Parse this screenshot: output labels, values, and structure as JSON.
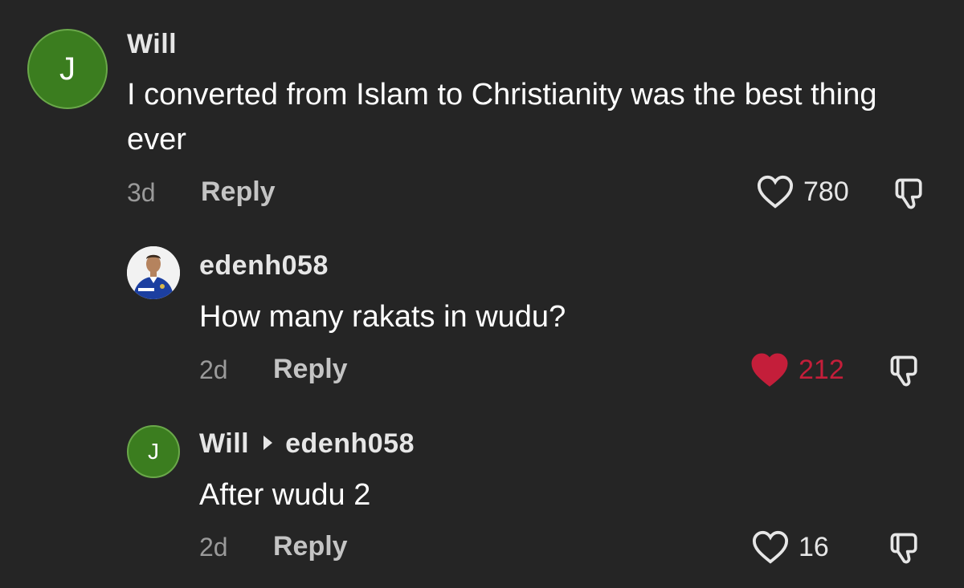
{
  "comments": [
    {
      "avatar_letter": "J",
      "username": "Will",
      "text": "I converted from Islam to Christianity was the best thing ever",
      "age": "3d",
      "reply_label": "Reply",
      "likes": "780",
      "liked": false
    },
    {
      "avatar_icon": "profile-photo-icon",
      "username": "edenh058",
      "text": "How many rakats in wudu?",
      "age": "2d",
      "reply_label": "Reply",
      "likes": "212",
      "liked": true
    },
    {
      "avatar_letter": "J",
      "username": "Will",
      "reply_to": "edenh058",
      "text": "After wudu 2",
      "age": "2d",
      "reply_label": "Reply",
      "likes": "16",
      "liked": false
    }
  ],
  "colors": {
    "background": "#252525",
    "avatar_green": "#3b7d1f",
    "liked_red": "#c41e3a",
    "muted_text": "#9a9a9a"
  }
}
